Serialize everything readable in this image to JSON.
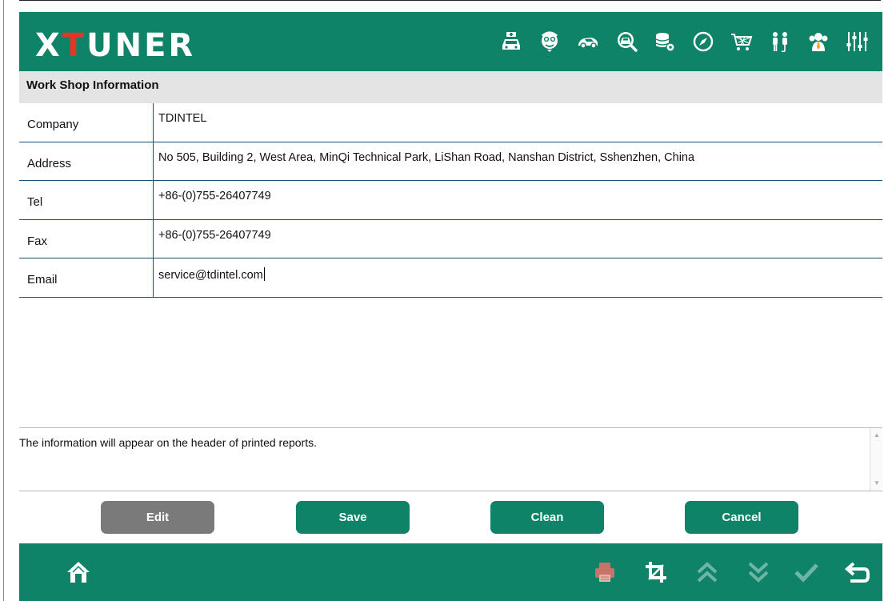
{
  "app": {
    "logo_prefix": "X",
    "logo_t": "T",
    "logo_suffix": "UNER",
    "brand_color": "#0f8368",
    "accent_color": "#e53527"
  },
  "toolbar": {
    "icons": [
      "car-doctor-icon",
      "technician-icon",
      "car-icon",
      "car-search-icon",
      "database-settings-icon",
      "compass-icon",
      "shopping-cart-icon",
      "users-icon",
      "support-icon",
      "sliders-icon"
    ]
  },
  "section": {
    "title": "Work Shop Information"
  },
  "fields": [
    {
      "label": "Company",
      "value": "TDINTEL"
    },
    {
      "label": "Address",
      "value": "No 505, Building 2, West Area, MinQi Technical Park, LiShan Road, Nanshan District, Sshenzhen, China"
    },
    {
      "label": "Tel",
      "value": "+86-(0)755-26407749"
    },
    {
      "label": "Fax",
      "value": "+86-(0)755-26407749"
    },
    {
      "label": "Email",
      "value": "service@tdintel.com"
    }
  ],
  "note": {
    "text": "The information will appear on the header of printed reports."
  },
  "buttons": {
    "edit": "Edit",
    "save": "Save",
    "clean": "Clean",
    "cancel": "Cancel"
  },
  "footer": {
    "icons": [
      "home-icon",
      "print-icon",
      "crop-icon",
      "page-up-icon",
      "page-down-icon",
      "confirm-icon",
      "back-icon"
    ],
    "disabled_color": "#6fb5a3",
    "print_color": "#c7736a"
  }
}
